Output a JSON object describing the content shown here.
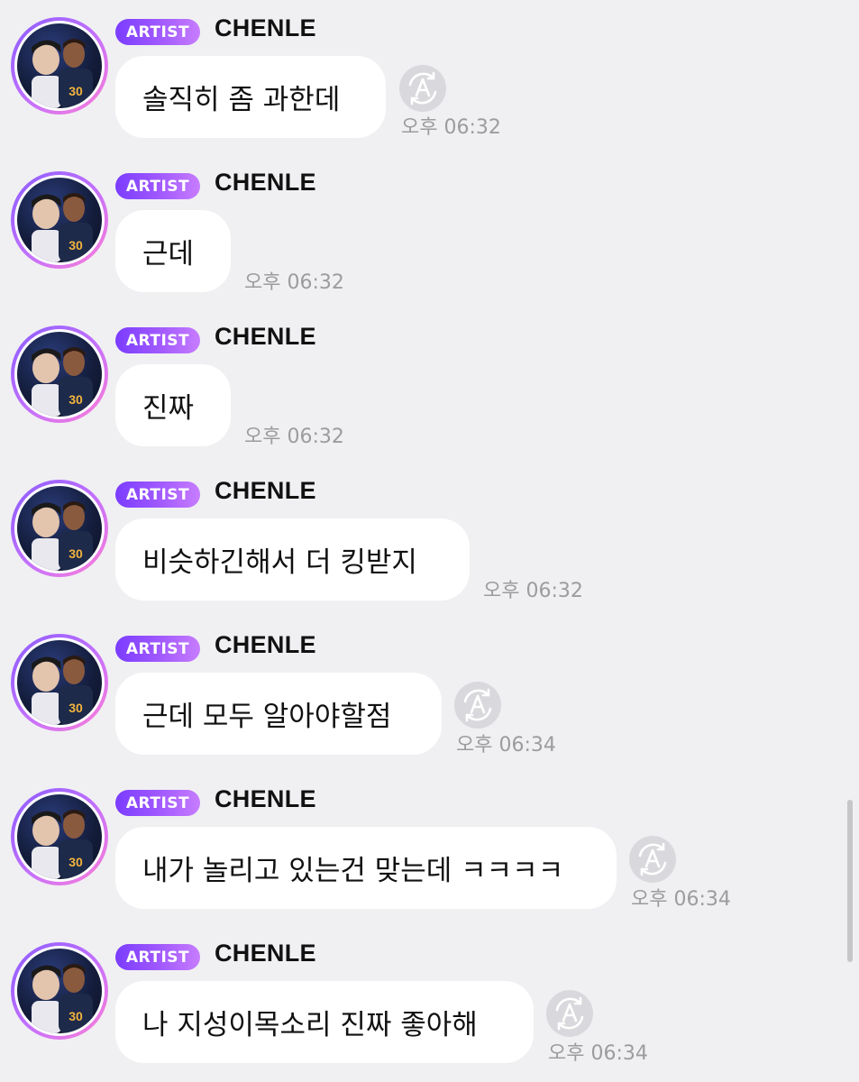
{
  "messages": [
    {
      "badge": "ARTIST",
      "sender": "CHENLE",
      "text": "솔직히 좀 과한데",
      "time": "오후 06:32",
      "translatable": true
    },
    {
      "badge": "ARTIST",
      "sender": "CHENLE",
      "text": "근데",
      "time": "오후 06:32",
      "translatable": false
    },
    {
      "badge": "ARTIST",
      "sender": "CHENLE",
      "text": "진짜",
      "time": "오후 06:32",
      "translatable": false
    },
    {
      "badge": "ARTIST",
      "sender": "CHENLE",
      "text": "비슷하긴해서 더 킹받지",
      "time": "오후 06:32",
      "translatable": false
    },
    {
      "badge": "ARTIST",
      "sender": "CHENLE",
      "text": "근데 모두 알아야할점",
      "time": "오후 06:34",
      "translatable": true
    },
    {
      "badge": "ARTIST",
      "sender": "CHENLE",
      "text": "내가 놀리고 있는건 맞는데 ㅋㅋㅋㅋ",
      "time": "오후 06:34",
      "translatable": true
    },
    {
      "badge": "ARTIST",
      "sender": "CHENLE",
      "text": "나 지성이목소리 진짜 좋아해",
      "time": "오후 06:34",
      "translatable": true
    }
  ],
  "colors": {
    "background": "#f0f0f2",
    "badge_gradient": [
      "#7a3cff",
      "#c77dff"
    ],
    "avatar_ring": [
      "#8a5cff",
      "#ff7fd5"
    ],
    "bubble": "#ffffff",
    "time_text": "#9c9c9f"
  },
  "icons": {
    "translate": "translate-icon",
    "avatar": "avatar"
  }
}
